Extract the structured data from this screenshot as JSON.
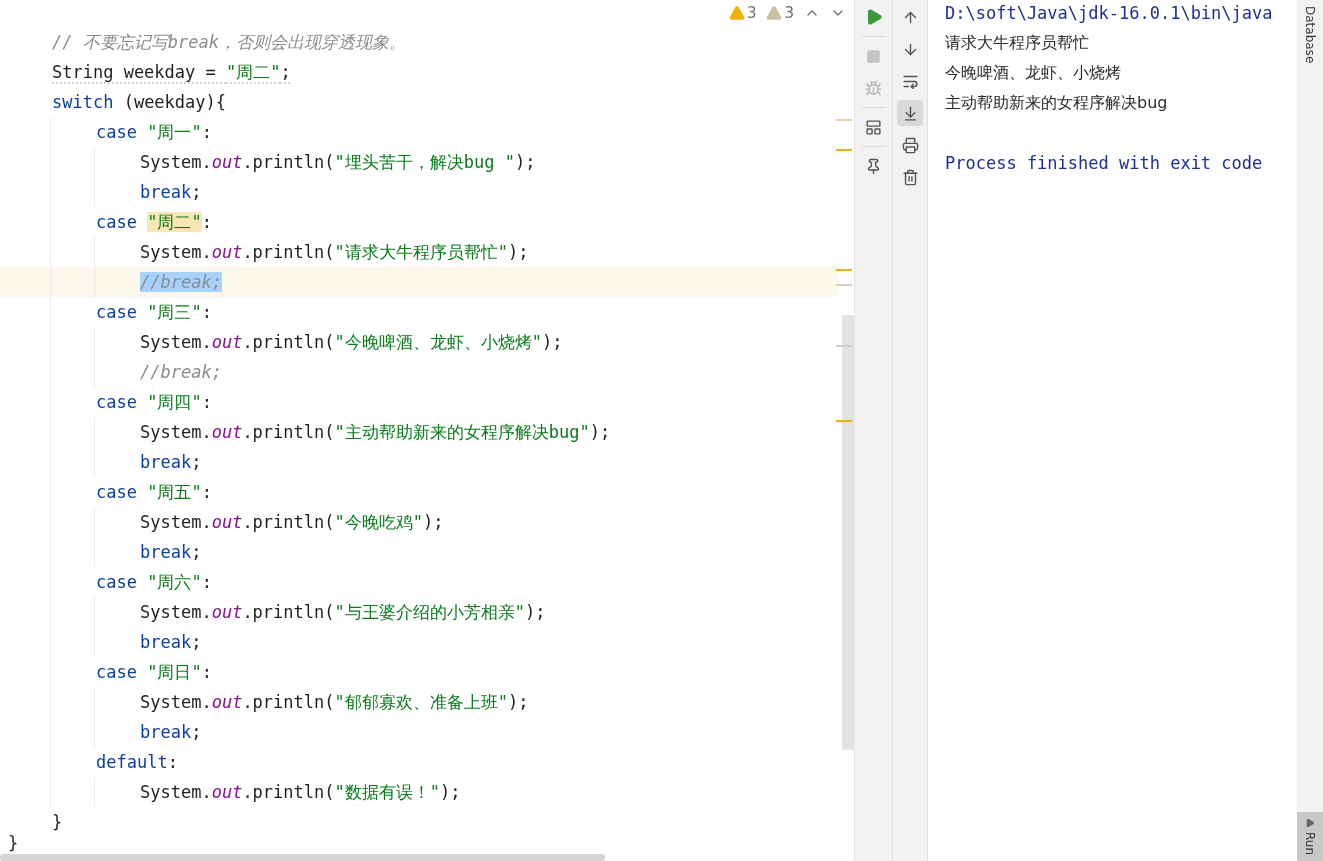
{
  "editor": {
    "inspections": [
      {
        "kind": "warning",
        "count": "3"
      },
      {
        "kind": "weak_warning",
        "count": "3"
      }
    ],
    "lines": [
      {
        "tokens": [
          {
            "kind": "comment",
            "text": "// 不要忘记写break，否则会出现穿透现象。"
          }
        ]
      },
      {
        "warning": true,
        "tokens": [
          {
            "kind": "plain",
            "text": "String weekday = "
          },
          {
            "kind": "string",
            "text": "\"周二\""
          },
          {
            "kind": "plain",
            "text": ";"
          }
        ]
      },
      {
        "tokens": [
          {
            "kind": "keyword",
            "text": "switch"
          },
          {
            "kind": "plain",
            "text": " (weekday){"
          }
        ],
        "children": [
          {
            "tokens": [
              {
                "kind": "keyword",
                "text": "case"
              },
              {
                "kind": "string",
                "text": "\"周一\""
              },
              {
                "kind": "plain",
                "text": ":"
              }
            ],
            "children": [
              {
                "tokens": [
                  {
                    "kind": "plain",
                    "text": "System."
                  },
                  {
                    "kind": "field",
                    "text": "out"
                  },
                  {
                    "kind": "plain",
                    "text": ".println("
                  },
                  {
                    "kind": "string",
                    "text": "\"埋头苦干，解决bug \""
                  },
                  {
                    "kind": "plain",
                    "text": ");"
                  }
                ]
              },
              {
                "tokens": [
                  {
                    "kind": "keyword",
                    "text": "break"
                  },
                  {
                    "kind": "plain",
                    "text": ";"
                  }
                ]
              }
            ]
          },
          {
            "tokens": [
              {
                "kind": "keyword",
                "text": "case"
              },
              {
                "kind": "string",
                "text": "\"周二\"",
                "highlighted": true
              },
              {
                "kind": "plain",
                "text": ":"
              }
            ],
            "children": [
              {
                "tokens": [
                  {
                    "kind": "plain",
                    "text": "System."
                  },
                  {
                    "kind": "field",
                    "text": "out"
                  },
                  {
                    "kind": "plain",
                    "text": ".println("
                  },
                  {
                    "kind": "string",
                    "text": "\"请求大牛程序员帮忙\""
                  },
                  {
                    "kind": "plain",
                    "text": ");"
                  }
                ]
              },
              {
                "current": true,
                "tokens": [
                  {
                    "kind": "comment_code",
                    "text": "//break;",
                    "selected": true
                  }
                ]
              }
            ]
          },
          {
            "tokens": [
              {
                "kind": "keyword",
                "text": "case"
              },
              {
                "kind": "string",
                "text": "\"周三\""
              },
              {
                "kind": "plain",
                "text": ":"
              }
            ],
            "children": [
              {
                "tokens": [
                  {
                    "kind": "plain",
                    "text": "System."
                  },
                  {
                    "kind": "field",
                    "text": "out"
                  },
                  {
                    "kind": "plain",
                    "text": ".println("
                  },
                  {
                    "kind": "string",
                    "text": "\"今晚啤酒、龙虾、小烧烤\""
                  },
                  {
                    "kind": "plain",
                    "text": ");"
                  }
                ]
              },
              {
                "tokens": [
                  {
                    "kind": "comment_code",
                    "text": "//break;"
                  }
                ]
              }
            ]
          },
          {
            "tokens": [
              {
                "kind": "keyword",
                "text": "case"
              },
              {
                "kind": "string",
                "text": "\"周四\""
              },
              {
                "kind": "plain",
                "text": ":"
              }
            ],
            "children": [
              {
                "tokens": [
                  {
                    "kind": "plain",
                    "text": "System."
                  },
                  {
                    "kind": "field",
                    "text": "out"
                  },
                  {
                    "kind": "plain",
                    "text": ".println("
                  },
                  {
                    "kind": "string",
                    "text": "\"主动帮助新来的女程序解决bug\""
                  },
                  {
                    "kind": "plain",
                    "text": ");"
                  }
                ]
              },
              {
                "tokens": [
                  {
                    "kind": "keyword",
                    "text": "break"
                  },
                  {
                    "kind": "plain",
                    "text": ";"
                  }
                ]
              }
            ]
          },
          {
            "tokens": [
              {
                "kind": "keyword",
                "text": "case"
              },
              {
                "kind": "string",
                "text": "\"周五\""
              },
              {
                "kind": "plain",
                "text": ":"
              }
            ],
            "children": [
              {
                "tokens": [
                  {
                    "kind": "plain",
                    "text": "System."
                  },
                  {
                    "kind": "field",
                    "text": "out"
                  },
                  {
                    "kind": "plain",
                    "text": ".println("
                  },
                  {
                    "kind": "string",
                    "text": "\"今晚吃鸡\""
                  },
                  {
                    "kind": "plain",
                    "text": ");"
                  }
                ]
              },
              {
                "tokens": [
                  {
                    "kind": "keyword",
                    "text": "break"
                  },
                  {
                    "kind": "plain",
                    "text": ";"
                  }
                ]
              }
            ]
          },
          {
            "tokens": [
              {
                "kind": "keyword",
                "text": "case"
              },
              {
                "kind": "string",
                "text": "\"周六\""
              },
              {
                "kind": "plain",
                "text": ":"
              }
            ],
            "children": [
              {
                "tokens": [
                  {
                    "kind": "plain",
                    "text": "System."
                  },
                  {
                    "kind": "field",
                    "text": "out"
                  },
                  {
                    "kind": "plain",
                    "text": ".println("
                  },
                  {
                    "kind": "string",
                    "text": "\"与王婆介绍的小芳相亲\""
                  },
                  {
                    "kind": "plain",
                    "text": ");"
                  }
                ]
              },
              {
                "tokens": [
                  {
                    "kind": "keyword",
                    "text": "break"
                  },
                  {
                    "kind": "plain",
                    "text": ";"
                  }
                ]
              }
            ]
          },
          {
            "tokens": [
              {
                "kind": "keyword",
                "text": "case"
              },
              {
                "kind": "string",
                "text": "\"周日\""
              },
              {
                "kind": "plain",
                "text": ":"
              }
            ],
            "children": [
              {
                "tokens": [
                  {
                    "kind": "plain",
                    "text": "System."
                  },
                  {
                    "kind": "field",
                    "text": "out"
                  },
                  {
                    "kind": "plain",
                    "text": ".println("
                  },
                  {
                    "kind": "string",
                    "text": "\"郁郁寡欢、准备上班\""
                  },
                  {
                    "kind": "plain",
                    "text": ");"
                  }
                ]
              },
              {
                "tokens": [
                  {
                    "kind": "keyword",
                    "text": "break"
                  },
                  {
                    "kind": "plain",
                    "text": ";"
                  }
                ]
              }
            ]
          },
          {
            "tokens": [
              {
                "kind": "keyword",
                "text": "default"
              },
              {
                "kind": "plain",
                "text": ":"
              }
            ],
            "children": [
              {
                "tokens": [
                  {
                    "kind": "plain",
                    "text": "System."
                  },
                  {
                    "kind": "field",
                    "text": "out"
                  },
                  {
                    "kind": "plain",
                    "text": ".println("
                  },
                  {
                    "kind": "string",
                    "text": "\"数据有误！\""
                  },
                  {
                    "kind": "plain",
                    "text": ");"
                  }
                ]
              }
            ]
          }
        ]
      },
      {
        "tokens": [
          {
            "kind": "plain",
            "text": "}"
          }
        ]
      }
    ],
    "outer_close": "}"
  },
  "console": {
    "lines": [
      {
        "kind": "command",
        "text": "D:\\soft\\Java\\jdk-16.0.1\\bin\\java"
      },
      {
        "kind": "output",
        "text": "请求大牛程序员帮忙"
      },
      {
        "kind": "output",
        "text": "今晚啤酒、龙虾、小烧烤"
      },
      {
        "kind": "output",
        "text": "主动帮助新来的女程序解决bug"
      },
      {
        "kind": "process",
        "text": "Process finished with exit code"
      }
    ],
    "scroll_to_end_on": true
  },
  "side_tabs": [
    {
      "label": "Database",
      "selected": false
    },
    {
      "label": "Run",
      "selected": true
    }
  ]
}
